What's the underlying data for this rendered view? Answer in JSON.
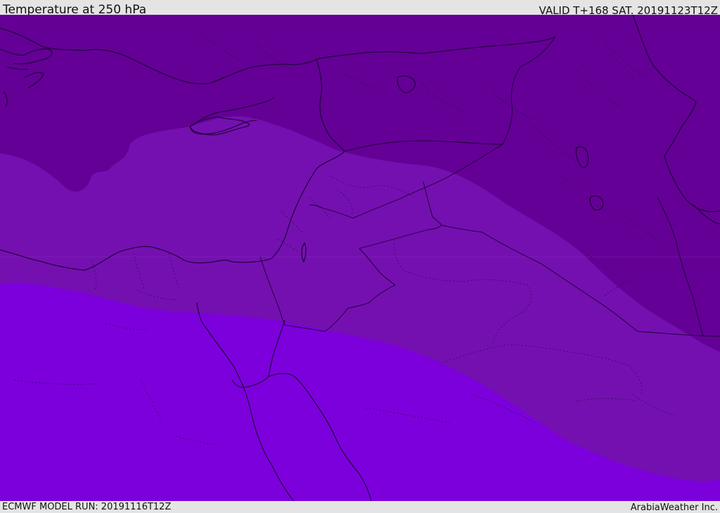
{
  "header": {
    "title": "Temperature at 250 hPa",
    "valid_time": "VALID T+168 SAT. 20191123T12Z"
  },
  "footer": {
    "model_run": "ECMWF MODEL RUN: 20191116T12Z",
    "credit": "ArabiaWeather Inc."
  },
  "map": {
    "field": "temperature",
    "level": "250 hPa",
    "region": "Eastern Mediterranean / Middle East",
    "band_colors": {
      "coldest": "#640096",
      "cold": "#7410b0",
      "mild": "#7c00dc"
    },
    "coast_color": "#1a0030"
  }
}
